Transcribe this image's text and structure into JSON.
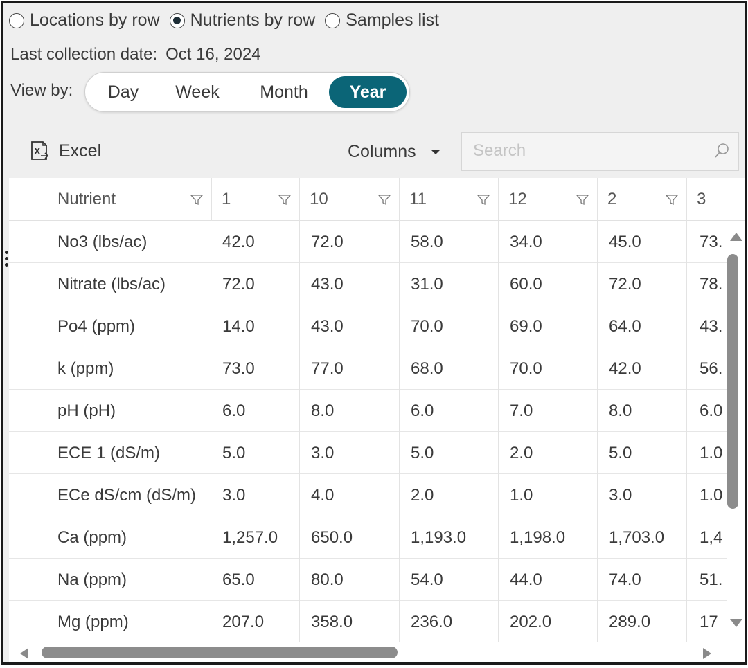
{
  "view_mode": {
    "options": [
      {
        "label": "Locations by row",
        "checked": false
      },
      {
        "label": "Nutrients by row",
        "checked": true
      },
      {
        "label": "Samples list",
        "checked": false
      }
    ]
  },
  "last_collection": {
    "label": "Last collection date:",
    "value": "Oct 16, 2024"
  },
  "view_by": {
    "label": "View by:",
    "options": [
      "Day",
      "Week",
      "Month",
      "Year"
    ],
    "active": "Year"
  },
  "toolbar": {
    "excel_label": "Excel",
    "columns_label": "Columns",
    "search_placeholder": "Search"
  },
  "table": {
    "headers": [
      "Nutrient",
      "1",
      "10",
      "11",
      "12",
      "2",
      "3"
    ],
    "rows": [
      [
        "No3 (lbs/ac)",
        "42.0",
        "72.0",
        "58.0",
        "34.0",
        "45.0",
        "73."
      ],
      [
        "Nitrate (lbs/ac)",
        "72.0",
        "43.0",
        "31.0",
        "60.0",
        "72.0",
        "78."
      ],
      [
        "Po4 (ppm)",
        "14.0",
        "43.0",
        "70.0",
        "69.0",
        "64.0",
        "43."
      ],
      [
        "k (ppm)",
        "73.0",
        "77.0",
        "68.0",
        "70.0",
        "42.0",
        "56."
      ],
      [
        "pH (pH)",
        "6.0",
        "8.0",
        "6.0",
        "7.0",
        "8.0",
        "6.0"
      ],
      [
        "ECE 1 (dS/m)",
        "5.0",
        "3.0",
        "5.0",
        "2.0",
        "5.0",
        "1.0"
      ],
      [
        "ECe dS/cm (dS/m)",
        "3.0",
        "4.0",
        "2.0",
        "1.0",
        "3.0",
        "1.0"
      ],
      [
        "Ca (ppm)",
        "1,257.0",
        "650.0",
        "1,193.0",
        "1,198.0",
        "1,703.0",
        "1,4"
      ],
      [
        "Na (ppm)",
        "65.0",
        "80.0",
        "54.0",
        "44.0",
        "74.0",
        "51."
      ],
      [
        "Mg (ppm)",
        "207.0",
        "358.0",
        "236.0",
        "202.0",
        "289.0",
        "17"
      ]
    ]
  },
  "colors": {
    "accent": "#0b6577",
    "frame": "#efefef"
  }
}
